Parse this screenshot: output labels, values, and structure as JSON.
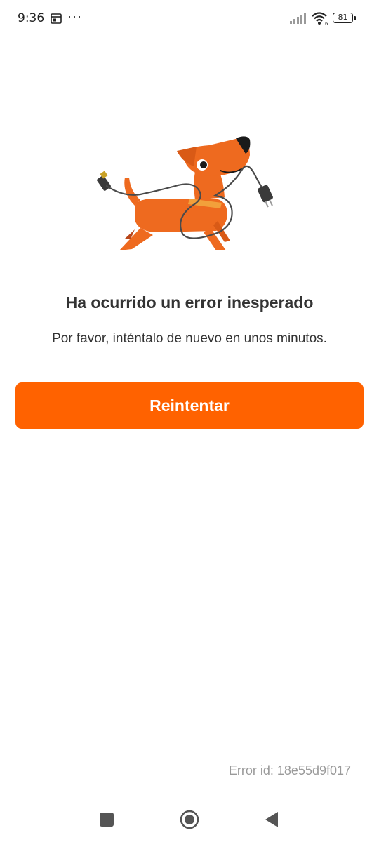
{
  "status_bar": {
    "time": "9:36",
    "more": "···",
    "battery": "81",
    "icons": [
      "calendar-icon",
      "signal-icon",
      "wifi-icon",
      "battery-icon"
    ]
  },
  "illustration": {
    "icon": "dog-with-cable-illustration",
    "colors": {
      "body": "#ee6a1f",
      "collar": "#f2a03b",
      "nose": "#1a1a1a",
      "cable": "#4a4a4a"
    }
  },
  "error": {
    "title": "Ha ocurrido un error inesperado",
    "subtitle": "Por favor, inténtalo de nuevo en unos minutos.",
    "retry_label": "Reintentar",
    "error_id": "Error id: 18e55d9f017"
  },
  "colors": {
    "accent": "#ff6200",
    "text": "#333333",
    "muted": "#9a9a9a"
  },
  "nav_bar": {
    "icons": [
      "recent-apps-icon",
      "home-icon",
      "back-icon"
    ]
  }
}
